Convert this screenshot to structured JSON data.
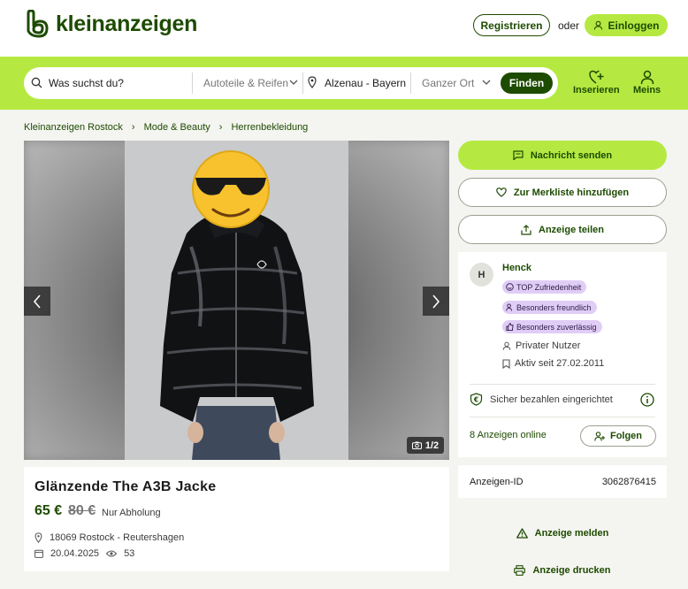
{
  "header": {
    "brand": "kleinanzeigen",
    "register_label": "Registrieren",
    "or_label": "oder",
    "login_label": "Einloggen"
  },
  "search": {
    "query_placeholder": "Was suchst du?",
    "category": "Autoteile & Reifen",
    "location": "Alzenau - Bayern",
    "radius": "Ganzer Ort",
    "find_label": "Finden"
  },
  "nav": {
    "post_label": "Inserieren",
    "account_label": "Meins"
  },
  "breadcrumb": [
    "Kleinanzeigen Rostock",
    "Mode & Beauty",
    "Herrenbekleidung"
  ],
  "gallery": {
    "counter": "1/2"
  },
  "ad": {
    "title": "Glänzende The A3B Jacke",
    "price": "65 €",
    "old_price": "80 €",
    "shipping": "Nur Abholung",
    "location": "18069 Rostock - Reutershagen",
    "date": "20.04.2025",
    "views": "53"
  },
  "actions": {
    "message": "Nachricht senden",
    "watchlist": "Zur Merkliste hinzufügen",
    "share": "Anzeige teilen",
    "report": "Anzeige melden",
    "print": "Anzeige drucken"
  },
  "seller": {
    "initial": "H",
    "name": "Henck",
    "badges": [
      "TOP Zufriedenheit",
      "Besonders freundlich",
      "Besonders zuverlässig"
    ],
    "type": "Privater Nutzer",
    "active_since": "Aktiv seit 27.02.2011",
    "safe_pay": "Sicher bezahlen eingerichtet",
    "ads_online": "8 Anzeigen online",
    "follow_label": "Folgen"
  },
  "ad_id": {
    "label": "Anzeigen-ID",
    "value": "3062876415"
  },
  "colors": {
    "brand_green": "#1d4b00",
    "accent_lime": "#b5e941",
    "badge_purple": "#e0cdf6"
  }
}
